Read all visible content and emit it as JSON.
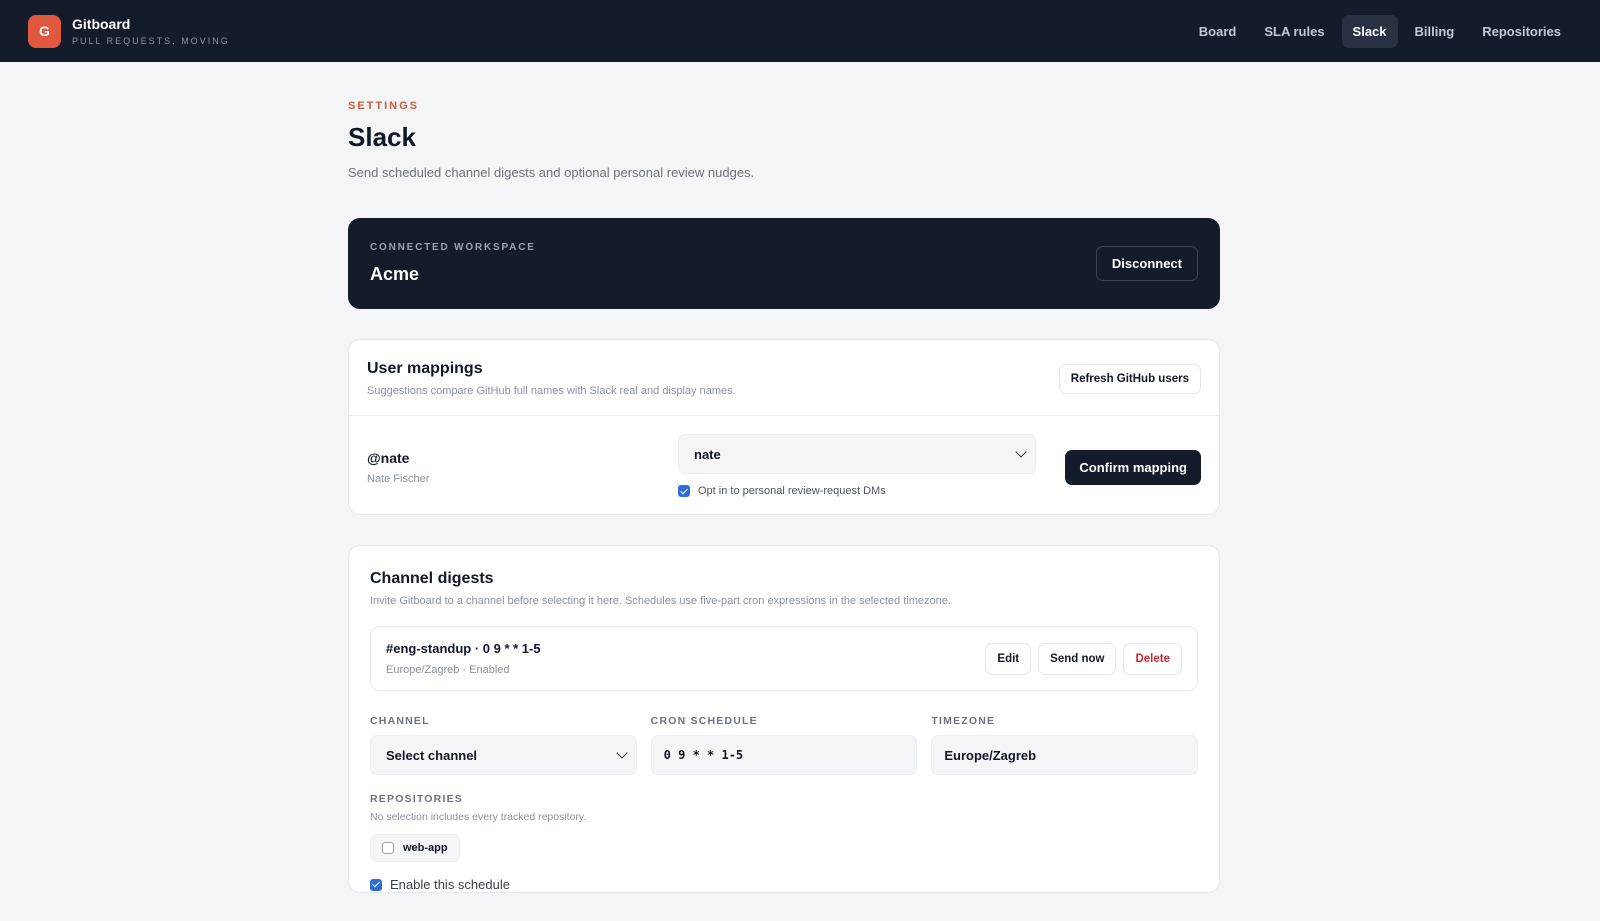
{
  "brand": {
    "logo_letter": "G",
    "name": "Gitboard",
    "tagline": "PULL REQUESTS, MOVING"
  },
  "nav": {
    "items": [
      {
        "label": "Board",
        "active": false
      },
      {
        "label": "SLA rules",
        "active": false
      },
      {
        "label": "Slack",
        "active": true
      },
      {
        "label": "Billing",
        "active": false
      },
      {
        "label": "Repositories",
        "active": false
      }
    ]
  },
  "page": {
    "eyebrow": "SETTINGS",
    "title": "Slack",
    "subtitle": "Send scheduled channel digests and optional personal review nudges."
  },
  "workspace": {
    "label": "CONNECTED WORKSPACE",
    "name": "Acme",
    "disconnect_label": "Disconnect"
  },
  "user_mappings": {
    "title": "User mappings",
    "description": "Suggestions compare GitHub full names with Slack real and display names.",
    "refresh_label": "Refresh GitHub users",
    "row": {
      "handle": "@nate",
      "full_name": "Nate Fischer",
      "selected": "nate",
      "optin_label": "Opt in to personal review-request DMs",
      "optin_checked": true,
      "confirm_label": "Confirm mapping"
    }
  },
  "digests": {
    "title": "Channel digests",
    "description": "Invite Gitboard to a channel before selecting it here. Schedules use five-part cron expressions in the selected timezone.",
    "item": {
      "title": "#eng-standup · 0 9 * * 1-5",
      "subtitle": "Europe/Zagreb · Enabled",
      "edit_label": "Edit",
      "send_label": "Send now",
      "delete_label": "Delete"
    },
    "form": {
      "channel_label": "CHANNEL",
      "channel_value": "Select channel",
      "cron_label": "CRON SCHEDULE",
      "cron_value": "0 9 * * 1-5",
      "timezone_label": "TIMEZONE",
      "timezone_value": "Europe/Zagreb",
      "repos_label": "REPOSITORIES",
      "repos_desc": "No selection includes every tracked repository.",
      "repo_option": "web-app",
      "repo_checked": false,
      "enable_label": "Enable this schedule",
      "enable_checked": true
    }
  },
  "colors": {
    "header_bg": "#141b2b",
    "accent": "#e0583f",
    "checkbox": "#2d6fd6",
    "danger": "#c52b3a"
  }
}
